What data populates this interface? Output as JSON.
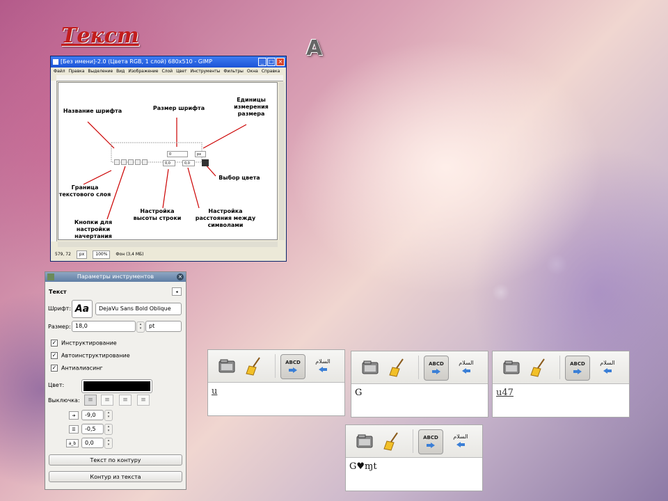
{
  "slide": {
    "title": "Текст",
    "text_tool_icon": "A"
  },
  "gimp_window": {
    "title": "[Без имени]-2.0 (Цвета RGB, 1 слой) 680x510 - GIMP",
    "menu": [
      "Файл",
      "Правка",
      "Выделение",
      "Вид",
      "Изображение",
      "Слой",
      "Цвет",
      "Инструменты",
      "Фильтры",
      "Окна",
      "Справка"
    ],
    "status": {
      "coords": "579, 72",
      "units": "px",
      "zoom": "100%",
      "info": "Фон (3,4 МБ)"
    },
    "annotations": {
      "font_name": "Название шрифта",
      "font_size": "Размер шрифта",
      "size_units": "Единицы измерения размера",
      "layer_border": "Граница текстового слоя",
      "style_buttons": "Кнопки для настройки начертания",
      "line_height": "Настройка высоты строки",
      "letter_spacing": "Настройка расстояния между символами",
      "color_choice": "Выбор цвета"
    },
    "toolbar_values": {
      "size": "0",
      "line": "0,0",
      "spacing": "0,0",
      "unit": "px"
    }
  },
  "tool_options": {
    "title": "Параметры инструментов",
    "section": "Текст",
    "font_label": "Шрифт:",
    "font_preview": "Aa",
    "font_value": "DejaVu Sans Bold Oblique",
    "size_label": "Размер:",
    "size_value": "18,0",
    "size_unit": "pt",
    "checkboxes": [
      {
        "label": "Инструктирование",
        "checked": true
      },
      {
        "label": "Автоинструктирование",
        "checked": true
      },
      {
        "label": "Антиалиасинг",
        "checked": true
      }
    ],
    "color_label": "Цвет:",
    "color_value": "#000000",
    "justify_label": "Выключка:",
    "indent_value": "-9,0",
    "line_spacing_value": "-0,5",
    "letter_spacing_value": "0,0",
    "letter_spacing_icon": "a_b",
    "button_path": "Текст по контуру",
    "button_from_text": "Контур из текста"
  },
  "toolbars": [
    {
      "ltr": "ABCD",
      "rtl": "السلام",
      "text": "u",
      "underlined": true
    },
    {
      "ltr": "ABCD",
      "rtl": "السلام",
      "text": "G",
      "underlined": false
    },
    {
      "ltr": "ABCD",
      "rtl": "السلام",
      "text": "u47",
      "underlined": true
    },
    {
      "ltr": "ABCD",
      "rtl": "السلام",
      "text": "G♥ɱt",
      "underlined": false
    }
  ]
}
